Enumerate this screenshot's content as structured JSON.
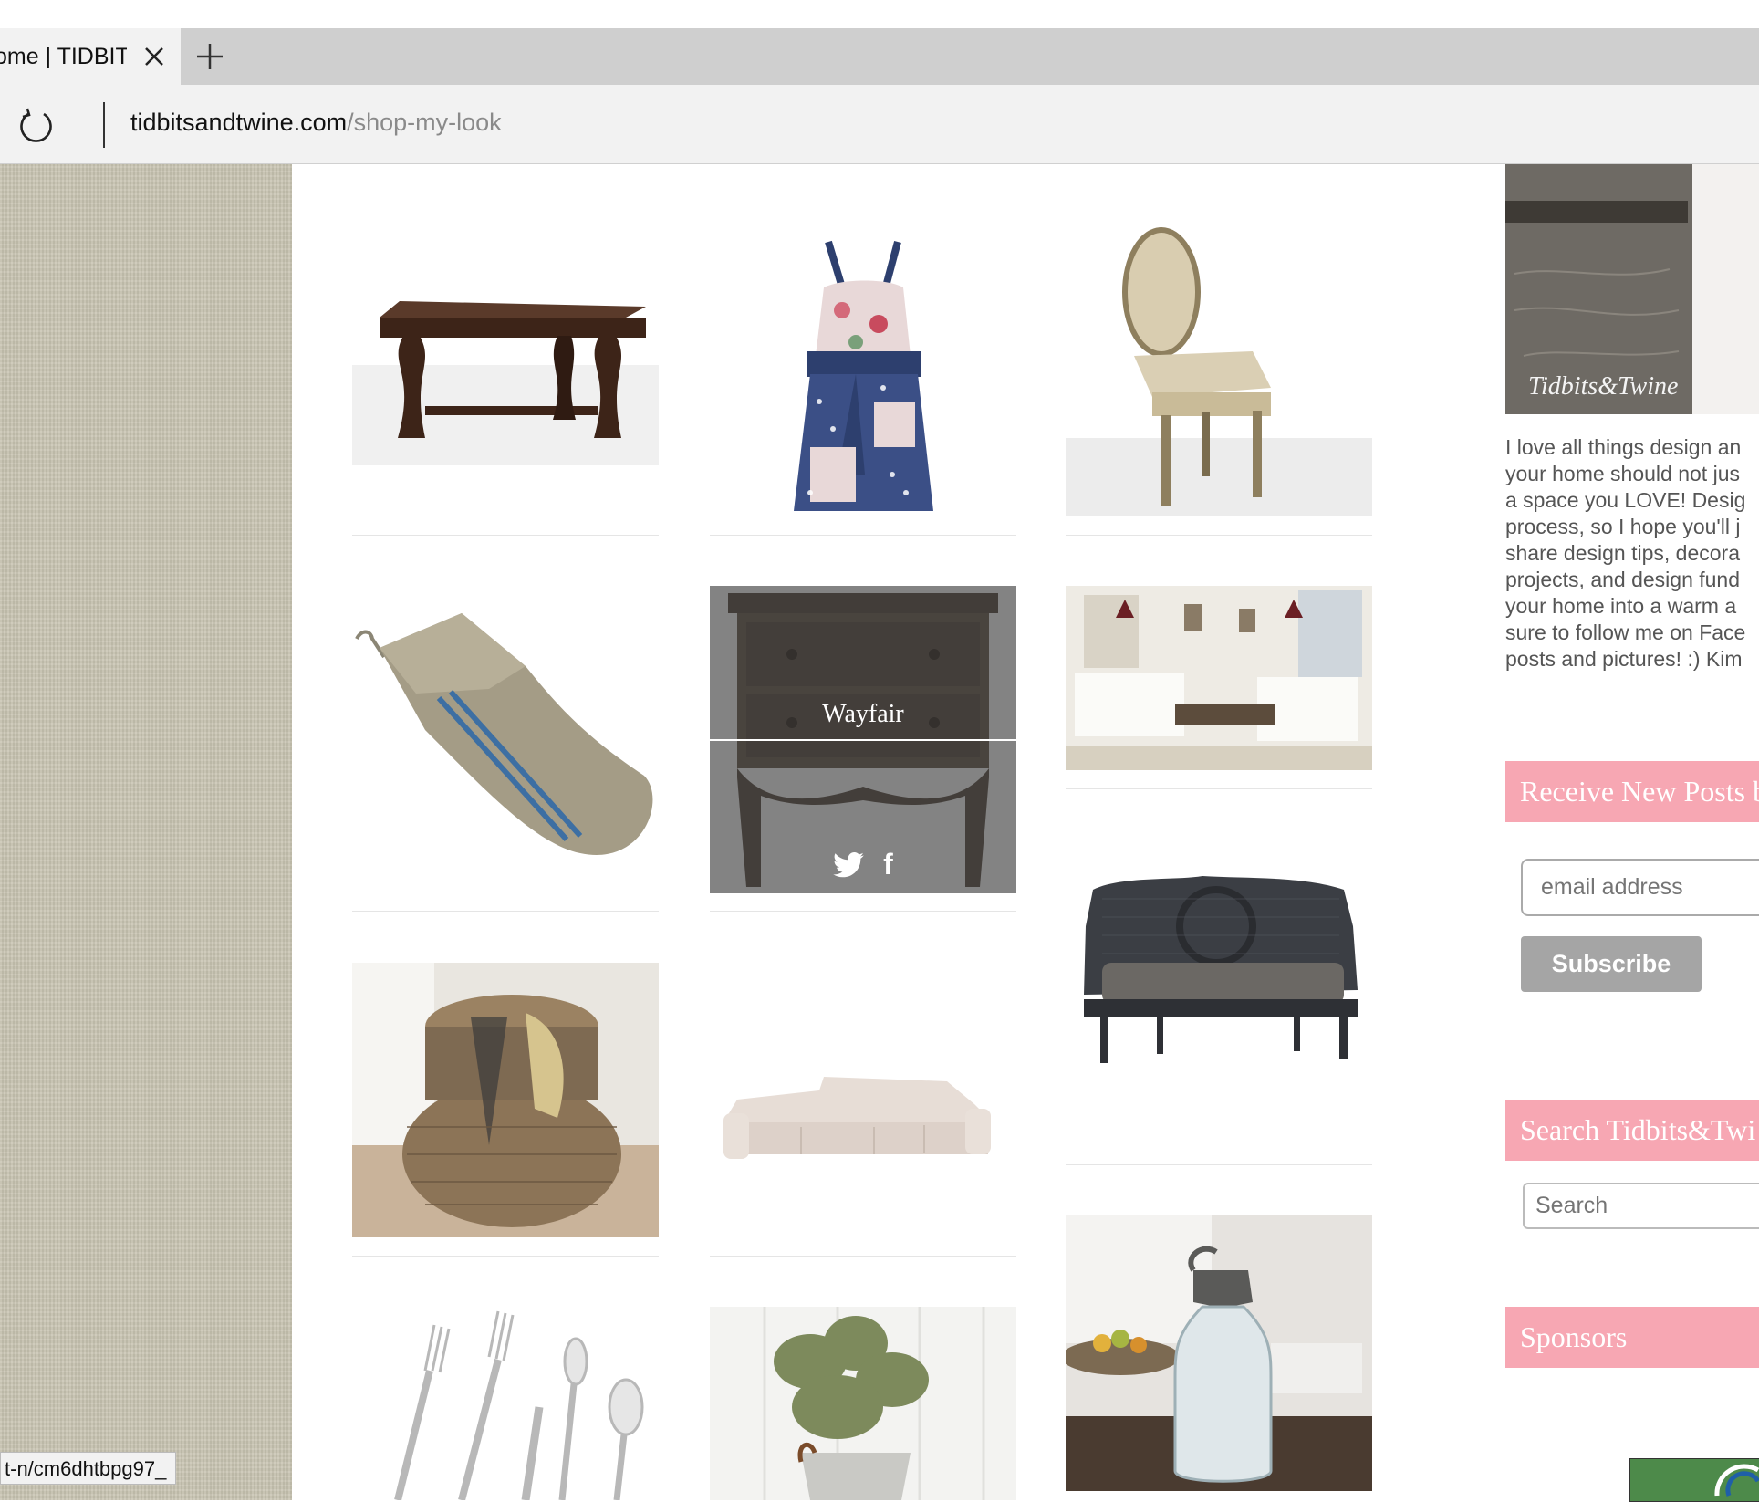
{
  "browser": {
    "tab_title": "ome | TIDBIT",
    "url_domain": "tidbitsandtwine.com",
    "url_path": "/shop-my-look",
    "status_url": "t-n/cm6dhtbpg97_"
  },
  "grid": {
    "hover_store": "Wayfair",
    "social_twitter": "🐦",
    "social_facebook": "f",
    "products": [
      {
        "name": "table-icon"
      },
      {
        "name": "apron-icon"
      },
      {
        "name": "chair-icon"
      },
      {
        "name": "stocking-icon"
      },
      {
        "name": "chest-icon"
      },
      {
        "name": "living-room-icon"
      },
      {
        "name": "basket-icon"
      },
      {
        "name": "sofa-icon"
      },
      {
        "name": "settee-icon"
      },
      {
        "name": "flatware-icon"
      },
      {
        "name": "olive-tree-icon"
      },
      {
        "name": "seltzer-bottle-icon"
      }
    ]
  },
  "sidebar": {
    "bio_lines": [
      "I love all things design an",
      "your home should not jus",
      "a space you LOVE! Desig",
      "process, so I hope you'll j",
      "share design tips, decora",
      "projects, and design fund",
      "your home into a warm a",
      "sure to follow me on Face",
      "posts and pictures! :) Kim"
    ],
    "receive_heading": "Receive New Posts b",
    "email_placeholder": "email address",
    "subscribe_label": "Subscribe",
    "search_heading": "Search Tidbits&Twi",
    "search_placeholder": "Search",
    "sponsors_heading": "Sponsors"
  },
  "colors": {
    "accent_pink": "#f7a7b3",
    "linen": "#c9c5b3"
  }
}
